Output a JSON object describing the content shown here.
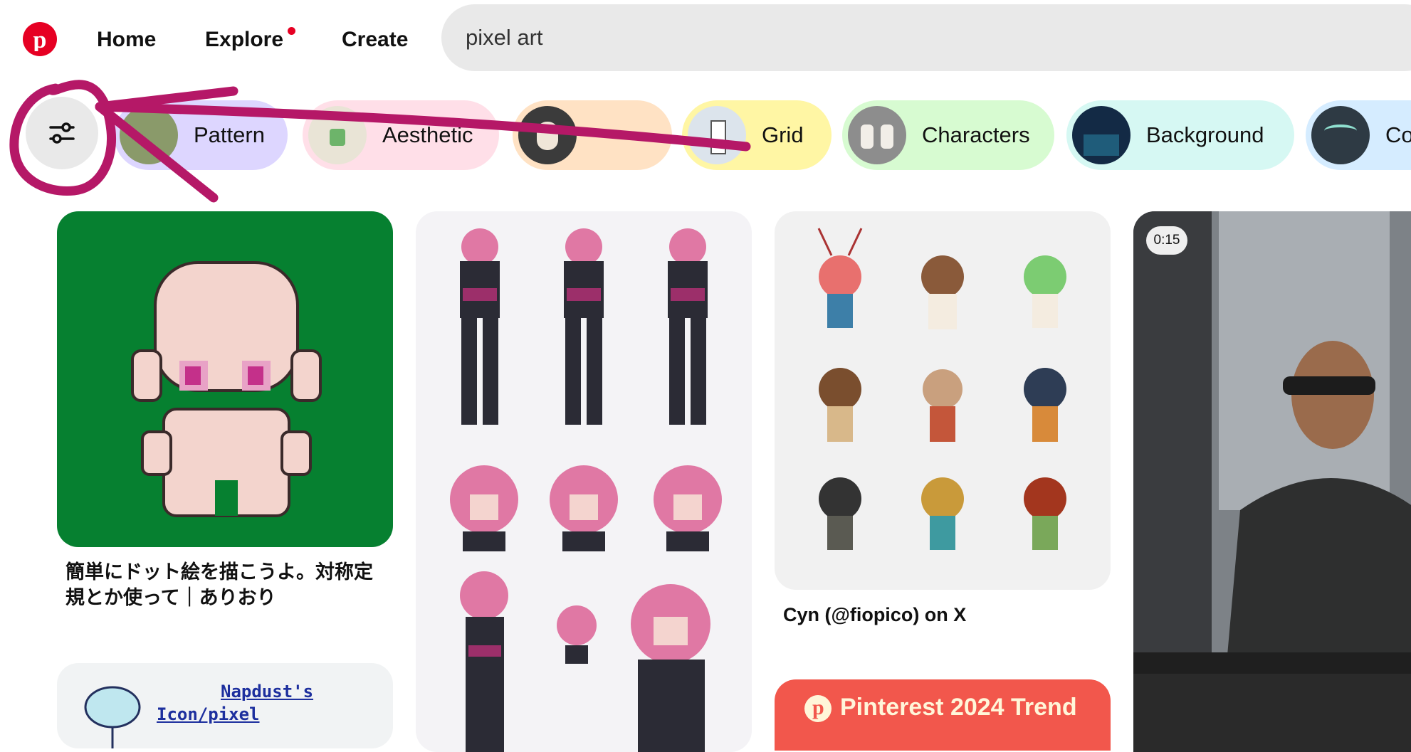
{
  "nav": {
    "home": "Home",
    "explore": "Explore",
    "create": "Create"
  },
  "search": {
    "value": "pixel art"
  },
  "chips": [
    {
      "label": "Pattern",
      "bg": "#ddd6ff"
    },
    {
      "label": "Aesthetic",
      "bg": "#ffdfe8"
    },
    {
      "label": "",
      "bg": "#ffe2c4"
    },
    {
      "label": "Grid",
      "bg": "#fff6a4"
    },
    {
      "label": "Characters",
      "bg": "#d7fbd1"
    },
    {
      "label": "Background",
      "bg": "#d6f8f3"
    },
    {
      "label": "Co",
      "bg": "#d5ecff"
    }
  ],
  "pins": [
    {
      "caption": "簡単にドット絵を描こうよ。対称定規とか使って｜ありおり"
    },
    {
      "caption": ""
    },
    {
      "caption": "Cyn (@fiopico) on X"
    },
    {
      "video_duration": "0:15"
    }
  ],
  "lower_pins": {
    "napdust_line1": "Napdust's",
    "napdust_line2": "Icon/pixel",
    "trend": "Pinterest 2024 Trend"
  },
  "colors": {
    "brand": "#e60023",
    "annotation": "#b51867"
  }
}
